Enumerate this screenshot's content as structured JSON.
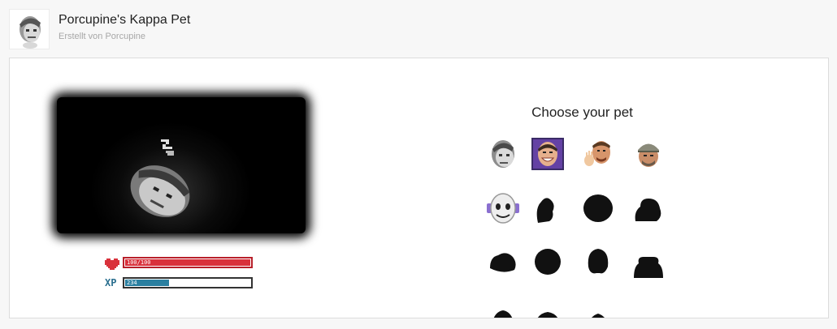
{
  "header": {
    "title": "Porcupine's Kappa Pet",
    "subtitle": "Erstellt von Porcupine",
    "avatar_icon": "kappa-face-icon"
  },
  "game": {
    "sleep_indicator": "sleeping-zz-icon",
    "pet_icon": "kappa-face-icon",
    "stats": {
      "health": {
        "icon": "heart-icon",
        "text": "100/100",
        "fraction": 1.0,
        "color": "#d9313b"
      },
      "xp": {
        "icon_label": "XP",
        "text": "234",
        "fraction": 0.35,
        "color": "#2a7fa0"
      }
    }
  },
  "chooser": {
    "heading": "Choose your pet",
    "pets": [
      {
        "name": "kappa",
        "icon": "kappa-face-icon",
        "selected": false,
        "locked": false
      },
      {
        "name": "grin",
        "icon": "smiling-man-face-icon",
        "selected": true,
        "locked": false
      },
      {
        "name": "wave",
        "icon": "waving-man-face-icon",
        "selected": false,
        "locked": false
      },
      {
        "name": "cap",
        "icon": "cap-man-face-icon",
        "selected": false,
        "locked": false
      },
      {
        "name": "robot",
        "icon": "robot-face-icon",
        "selected": false,
        "locked": false
      },
      {
        "name": "locked-6",
        "icon": "locked-silhouette-icon",
        "selected": false,
        "locked": true
      },
      {
        "name": "locked-7",
        "icon": "locked-silhouette-icon",
        "selected": false,
        "locked": true
      },
      {
        "name": "locked-8",
        "icon": "locked-silhouette-icon",
        "selected": false,
        "locked": true
      },
      {
        "name": "locked-9",
        "icon": "locked-silhouette-icon",
        "selected": false,
        "locked": true
      },
      {
        "name": "locked-10",
        "icon": "locked-silhouette-icon",
        "selected": false,
        "locked": true
      },
      {
        "name": "locked-11",
        "icon": "locked-silhouette-icon",
        "selected": false,
        "locked": true
      },
      {
        "name": "locked-12",
        "icon": "locked-silhouette-icon",
        "selected": false,
        "locked": true
      },
      {
        "name": "locked-13",
        "icon": "locked-silhouette-icon",
        "selected": false,
        "locked": true
      },
      {
        "name": "locked-14",
        "icon": "locked-silhouette-icon",
        "selected": false,
        "locked": true
      },
      {
        "name": "locked-15",
        "icon": "locked-silhouette-icon",
        "selected": false,
        "locked": true
      }
    ]
  }
}
